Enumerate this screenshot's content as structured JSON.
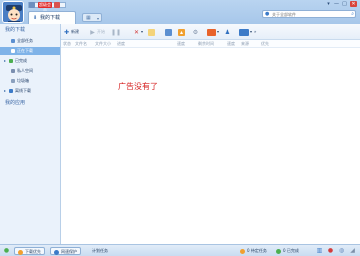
{
  "titlebar": {
    "vip_badge": "超级会员",
    "tabs": [
      {
        "label": "我的下载",
        "icon": "download-icon"
      }
    ],
    "apps_tab_icon": "grid-icon",
    "window_buttons": [
      "▾",
      "—",
      "□",
      "✕"
    ],
    "search_placeholder": "关于全部软件"
  },
  "sidebar": {
    "section_download": "我的下载",
    "items": [
      {
        "label": "全部任务",
        "icon": "all-tasks-icon"
      },
      {
        "label": "正在下载",
        "icon": "downloading-icon",
        "selected": true
      },
      {
        "label": "已完成",
        "icon": "completed-icon",
        "expandable": true
      },
      {
        "label": "私人空间",
        "icon": "private-space-icon"
      },
      {
        "label": "垃圾箱",
        "icon": "trash-icon"
      },
      {
        "label": "离线下载",
        "icon": "offline-download-icon",
        "expandable": true
      }
    ],
    "section_apps": "我的应用"
  },
  "toolbar": {
    "buttons": [
      {
        "label": "新建",
        "icon": "new-task-icon"
      },
      {
        "label": "开始",
        "icon": "play-icon"
      },
      {
        "label": "",
        "icon": "pause-icon"
      },
      {
        "label": "",
        "icon": "delete-icon"
      },
      {
        "label": "",
        "icon": "folder-icon"
      },
      {
        "label": "",
        "icon": "move-icon"
      },
      {
        "label": "",
        "icon": "up-icon"
      },
      {
        "label": "",
        "icon": "settings-icon"
      },
      {
        "label": "",
        "icon": "speed-icon"
      },
      {
        "label": "",
        "icon": "user-icon"
      },
      {
        "label": "",
        "icon": "app-icon"
      }
    ]
  },
  "columns": [
    "状态",
    "文件名",
    "文件大小",
    "进度",
    "速度",
    "剩余时间",
    "速度",
    "来源",
    "优先"
  ],
  "main": {
    "ad_text": "广告没有了"
  },
  "statusbar": {
    "tabs": [
      "下载优先",
      "网速保护",
      "计划任务"
    ],
    "right_items": [
      "0",
      "0"
    ],
    "right_item_labels": [
      "待定任务",
      "已完成"
    ]
  },
  "colors": {
    "accent": "#3c7bc8",
    "selected_row": "#7fb3e8",
    "ad_red": "#d62020"
  }
}
